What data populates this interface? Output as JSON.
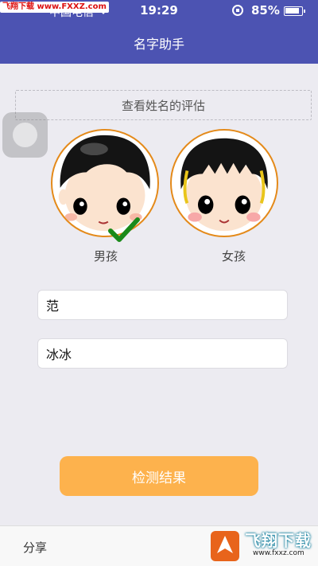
{
  "status_bar": {
    "watermark": "飞翔下载 www.FXXZ.com",
    "carrier": "中国电信",
    "time": "19:29",
    "battery": "85%"
  },
  "nav": {
    "title": "名字助手"
  },
  "eval_link": "查看姓名的评估",
  "gender": {
    "male_label": "男孩",
    "female_label": "女孩",
    "selected": "male"
  },
  "inputs": {
    "surname_value": "范",
    "given_name_value": "冰冰"
  },
  "submit_label": "检测结果",
  "bottom": {
    "share_label": "分享",
    "brand_text": "飞翔下载",
    "brand_url": "www.fxxz.com"
  },
  "colors": {
    "header": "#4c53b2",
    "button": "#fdb24d",
    "avatar_ring": "#e48a1a",
    "check": "#1a8a1a"
  }
}
